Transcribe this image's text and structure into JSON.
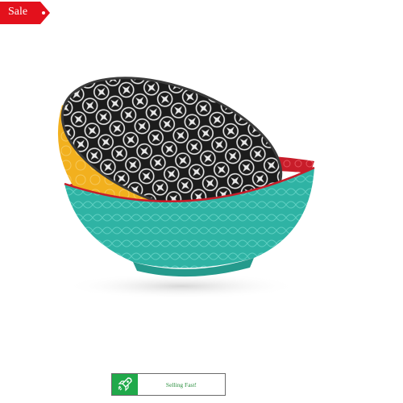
{
  "sale_tag": {
    "label": "Sale",
    "color": "#e3111c"
  },
  "product": {
    "image_icon": "bowl-set-image",
    "bowl_colors": {
      "teal": "#2fb3a4",
      "yellow": "#f2b01e",
      "black": "#1c1c1c",
      "red": "#c81d2a"
    }
  },
  "badge": {
    "label": "Selling Fast!",
    "icon": "rocket-icon",
    "accent": "#20a94a",
    "text_color": "#2a8f3e"
  }
}
